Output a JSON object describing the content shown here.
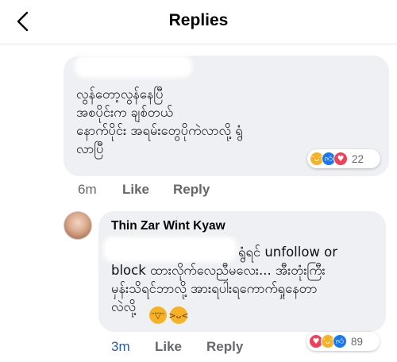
{
  "header": {
    "title": "Replies"
  },
  "comment1": {
    "lines": [
      "လွန်တော့လွန်နေပြီ",
      "အစပိုင်းက ချစ်တယ်",
      "နောက်ပိုင်း အရမ်းတွေပိုကဲလာလို့ ရွံ",
      "လာပြီ"
    ],
    "time": "6m",
    "like_label": "Like",
    "reply_label": "Reply",
    "reactions": {
      "icons": [
        "haha-icon",
        "like-icon",
        "love-icon"
      ],
      "count": "22"
    }
  },
  "comment2": {
    "author": "Thin Zar Wint Kyaw",
    "lines": [
      "ရွံရင် unfollow or",
      "block ထားလိုက်လေညီမလေး... အီးတုံးကြီး",
      "မှန်းသိရင်ဘာလို့ အားရပါးရကောက်ရှုနေတာ",
      "လဲလို့"
    ],
    "time": "3m",
    "like_label": "Like",
    "reply_label": "Reply",
    "reactions": {
      "icons": [
        "love-icon",
        "haha-icon",
        "like-icon"
      ],
      "count": "89"
    }
  },
  "colors": {
    "accent": "#1877f2",
    "bubble": "#eff0f3",
    "meta_text": "#65676b",
    "time_link": "#1d5fb8"
  }
}
